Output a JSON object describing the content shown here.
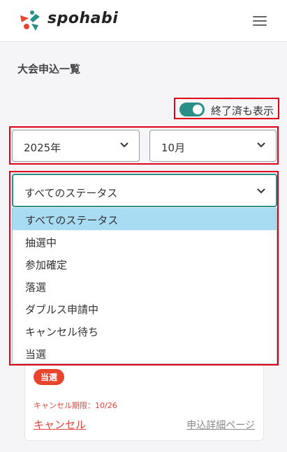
{
  "header": {
    "brand": "spohabi",
    "logo_icon": "spohabi-logo-icon",
    "menu_icon": "hamburger-menu-icon"
  },
  "page": {
    "title": "大会申込一覧"
  },
  "filters": {
    "show_finished_label": "終了済も表示",
    "show_finished_on": true,
    "year": "2025年",
    "month": "10月",
    "status": "すべてのステータス",
    "status_options": [
      "すべてのステータス",
      "抽選中",
      "参加確定",
      "落選",
      "ダブルス申請中",
      "キャンセル待ち",
      "当選"
    ],
    "selected_index": 0
  },
  "card": {
    "badge": "当選",
    "deadline": "キャンセル期限：10/26",
    "cancel_label": "キャンセル",
    "detail_label": "申込詳細ページ"
  },
  "colors": {
    "accent": "#2a8f86",
    "highlight": "#e0001a",
    "badge": "#e8452e",
    "selected_option": "#a7dcf3"
  }
}
